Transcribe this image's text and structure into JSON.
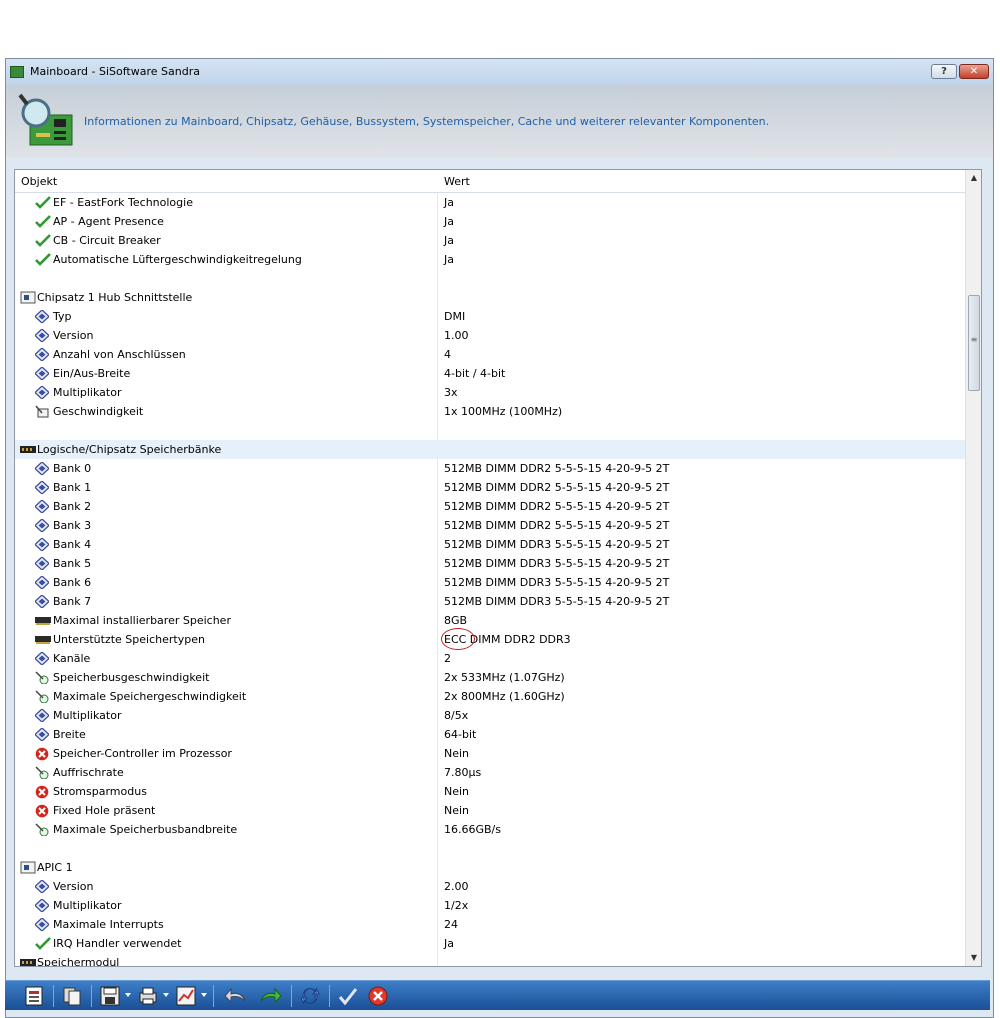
{
  "window": {
    "title": "Mainboard - SiSoftware Sandra",
    "help_label": "?",
    "close_label": "✕"
  },
  "header": {
    "description": "Informationen zu Mainboard, Chipsatz, Gehäuse, Bussystem, Systemspeicher, Cache und weiterer relevanter Komponenten."
  },
  "table": {
    "columns": [
      "Objekt",
      "Wert"
    ],
    "rows": [
      {
        "kind": "item",
        "icon": "check-icon",
        "name": "EF - EastFork Technologie",
        "value": "Ja"
      },
      {
        "kind": "item",
        "icon": "check-icon",
        "name": "AP - Agent Presence",
        "value": "Ja"
      },
      {
        "kind": "item",
        "icon": "check-icon",
        "name": "CB - Circuit Breaker",
        "value": "Ja"
      },
      {
        "kind": "item",
        "icon": "check-icon",
        "name": "Automatische Lüftergeschwindigkeitregelung",
        "value": "Ja"
      },
      {
        "kind": "blank",
        "icon": "",
        "name": "",
        "value": ""
      },
      {
        "kind": "section",
        "icon": "chip-icon",
        "name": "Chipsatz 1 Hub Schnittstelle",
        "value": ""
      },
      {
        "kind": "item",
        "icon": "diamond-icon",
        "name": "Typ",
        "value": "DMI"
      },
      {
        "kind": "item",
        "icon": "diamond-icon",
        "name": "Version",
        "value": "1.00"
      },
      {
        "kind": "item",
        "icon": "diamond-icon",
        "name": "Anzahl von Anschlüssen",
        "value": "4"
      },
      {
        "kind": "item",
        "icon": "diamond-icon",
        "name": "Ein/Aus-Breite",
        "value": "4-bit / 4-bit"
      },
      {
        "kind": "item",
        "icon": "diamond-icon",
        "name": "Multiplikator",
        "value": "3x"
      },
      {
        "kind": "item",
        "icon": "speed-icon",
        "name": "Geschwindigkeit",
        "value": "1x 100MHz (100MHz)"
      },
      {
        "kind": "blank",
        "icon": "",
        "name": "",
        "value": ""
      },
      {
        "kind": "section",
        "icon": "memory-icon",
        "name": "Logische/Chipsatz Speicherbänke",
        "value": "",
        "highlight": true
      },
      {
        "kind": "item",
        "icon": "diamond-icon",
        "name": "Bank 0",
        "value": "512MB DIMM DDR2 5-5-5-15 4-20-9-5 2T"
      },
      {
        "kind": "item",
        "icon": "diamond-icon",
        "name": "Bank 1",
        "value": "512MB DIMM DDR2 5-5-5-15 4-20-9-5 2T"
      },
      {
        "kind": "item",
        "icon": "diamond-icon",
        "name": "Bank 2",
        "value": "512MB DIMM DDR2 5-5-5-15 4-20-9-5 2T"
      },
      {
        "kind": "item",
        "icon": "diamond-icon",
        "name": "Bank 3",
        "value": "512MB DIMM DDR2 5-5-5-15 4-20-9-5 2T"
      },
      {
        "kind": "item",
        "icon": "diamond-icon",
        "name": "Bank 4",
        "value": "512MB DIMM DDR3 5-5-5-15 4-20-9-5 2T"
      },
      {
        "kind": "item",
        "icon": "diamond-icon",
        "name": "Bank 5",
        "value": "512MB DIMM DDR3 5-5-5-15 4-20-9-5 2T"
      },
      {
        "kind": "item",
        "icon": "diamond-icon",
        "name": "Bank 6",
        "value": "512MB DIMM DDR3 5-5-5-15 4-20-9-5 2T"
      },
      {
        "kind": "item",
        "icon": "diamond-icon",
        "name": "Bank 7",
        "value": "512MB DIMM DDR3 5-5-5-15 4-20-9-5 2T"
      },
      {
        "kind": "item",
        "icon": "memory-stick-icon",
        "name": "Maximal installierbarer Speicher",
        "value": "8GB"
      },
      {
        "kind": "item",
        "icon": "memory-stick-icon",
        "name": "Unterstützte Speichertypen",
        "value": "ECC DIMM DDR2 DDR3"
      },
      {
        "kind": "item",
        "icon": "diamond-icon",
        "name": "Kanäle",
        "value": "2"
      },
      {
        "kind": "item",
        "icon": "gauge-icon",
        "name": "Speicherbusgeschwindigkeit",
        "value": "2x 533MHz (1.07GHz)"
      },
      {
        "kind": "item",
        "icon": "gauge-icon",
        "name": "Maximale Speichergeschwindigkeit",
        "value": "2x 800MHz (1.60GHz)"
      },
      {
        "kind": "item",
        "icon": "diamond-icon",
        "name": "Multiplikator",
        "value": "8/5x"
      },
      {
        "kind": "item",
        "icon": "diamond-icon",
        "name": "Breite",
        "value": "64-bit"
      },
      {
        "kind": "item",
        "icon": "error-icon",
        "name": "Speicher-Controller im Prozessor",
        "value": "Nein"
      },
      {
        "kind": "item",
        "icon": "gauge-icon",
        "name": "Auffrischrate",
        "value": "7.80µs"
      },
      {
        "kind": "item",
        "icon": "error-icon",
        "name": "Stromsparmodus",
        "value": "Nein"
      },
      {
        "kind": "item",
        "icon": "error-icon",
        "name": "Fixed Hole präsent",
        "value": "Nein"
      },
      {
        "kind": "item",
        "icon": "gauge-icon",
        "name": "Maximale Speicherbusbandbreite",
        "value": "16.66GB/s"
      },
      {
        "kind": "blank",
        "icon": "",
        "name": "",
        "value": ""
      },
      {
        "kind": "section",
        "icon": "chip-icon",
        "name": "APIC 1",
        "value": ""
      },
      {
        "kind": "item",
        "icon": "diamond-icon",
        "name": "Version",
        "value": "2.00"
      },
      {
        "kind": "item",
        "icon": "diamond-icon",
        "name": "Multiplikator",
        "value": "1/2x"
      },
      {
        "kind": "item",
        "icon": "diamond-icon",
        "name": "Maximale Interrupts",
        "value": "24"
      },
      {
        "kind": "item",
        "icon": "check-icon",
        "name": "IRQ Handler verwendet",
        "value": "Ja"
      },
      {
        "kind": "section",
        "icon": "memory-icon",
        "name": "Speichermodul",
        "value": ""
      }
    ]
  },
  "colors": {
    "accent_text": "#1f5fa8",
    "check": "#2f9a2f",
    "diamond": "#3a4fa0",
    "error": "#d0261b",
    "toolbar": "#2a66b2",
    "annotation": "#c0201e"
  },
  "toolbar": {
    "icons": [
      "report-icon",
      "copy-icon",
      "save-icon",
      "print-icon",
      "chart-icon",
      "back-icon",
      "forward-icon",
      "refresh-icon",
      "ok-icon",
      "cancel-icon"
    ]
  }
}
